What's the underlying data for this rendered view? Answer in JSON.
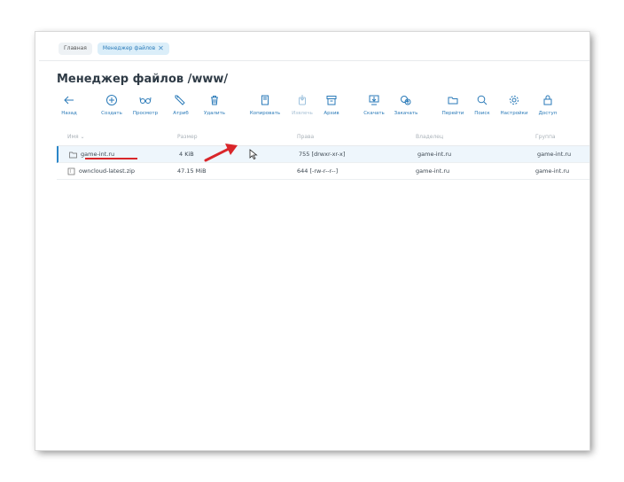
{
  "tabs": [
    {
      "label": "Главная",
      "active": false
    },
    {
      "label": "Менеджер файлов",
      "active": true,
      "close": "✕"
    }
  ],
  "page_title": "Менеджер файлов /www/",
  "toolbar": [
    {
      "label": "Назад",
      "icon": "back-arrow-icon",
      "enabled": true
    },
    {
      "label": "Создать",
      "icon": "plus-circle-icon",
      "enabled": true
    },
    {
      "label": "Просмотр",
      "icon": "glasses-icon",
      "enabled": true
    },
    {
      "label": "Атриб",
      "icon": "tag-icon",
      "enabled": true
    },
    {
      "label": "Удалить",
      "icon": "trash-icon",
      "enabled": true
    },
    {
      "label": "Копировать",
      "icon": "copy-icon",
      "enabled": true
    },
    {
      "label": "Извлечь",
      "icon": "extract-icon",
      "enabled": false
    },
    {
      "label": "Архив",
      "icon": "archive-icon",
      "enabled": true
    },
    {
      "label": "Скачать",
      "icon": "download-icon",
      "enabled": true
    },
    {
      "label": "Закачать",
      "icon": "upload-icon",
      "enabled": true
    },
    {
      "label": "Перейти",
      "icon": "folder-icon",
      "enabled": true
    },
    {
      "label": "Поиск",
      "icon": "search-icon",
      "enabled": true
    },
    {
      "label": "Настройки",
      "icon": "gear-icon",
      "enabled": true
    },
    {
      "label": "Доступ",
      "icon": "lock-icon",
      "enabled": true
    }
  ],
  "table": {
    "columns": [
      "Имя",
      "Размер",
      "Права",
      "Владелец",
      "Группа"
    ],
    "sort_indicator": "⌄",
    "rows": [
      {
        "name": "game-int.ru",
        "type": "folder",
        "size": "4 KiB",
        "perms": "755 [drwxr-xr-x]",
        "owner": "game-int.ru",
        "group": "game-int.ru",
        "selected": true
      },
      {
        "name": "owncloud-latest.zip",
        "type": "archive",
        "size": "47.15 MiB",
        "perms": "644 [-rw-r--r--]",
        "owner": "game-int.ru",
        "group": "game-int.ru",
        "selected": false
      }
    ]
  },
  "colors": {
    "accent": "#2b7bb9",
    "annotation": "#d9262a",
    "selected_row": "#eef6fc"
  }
}
